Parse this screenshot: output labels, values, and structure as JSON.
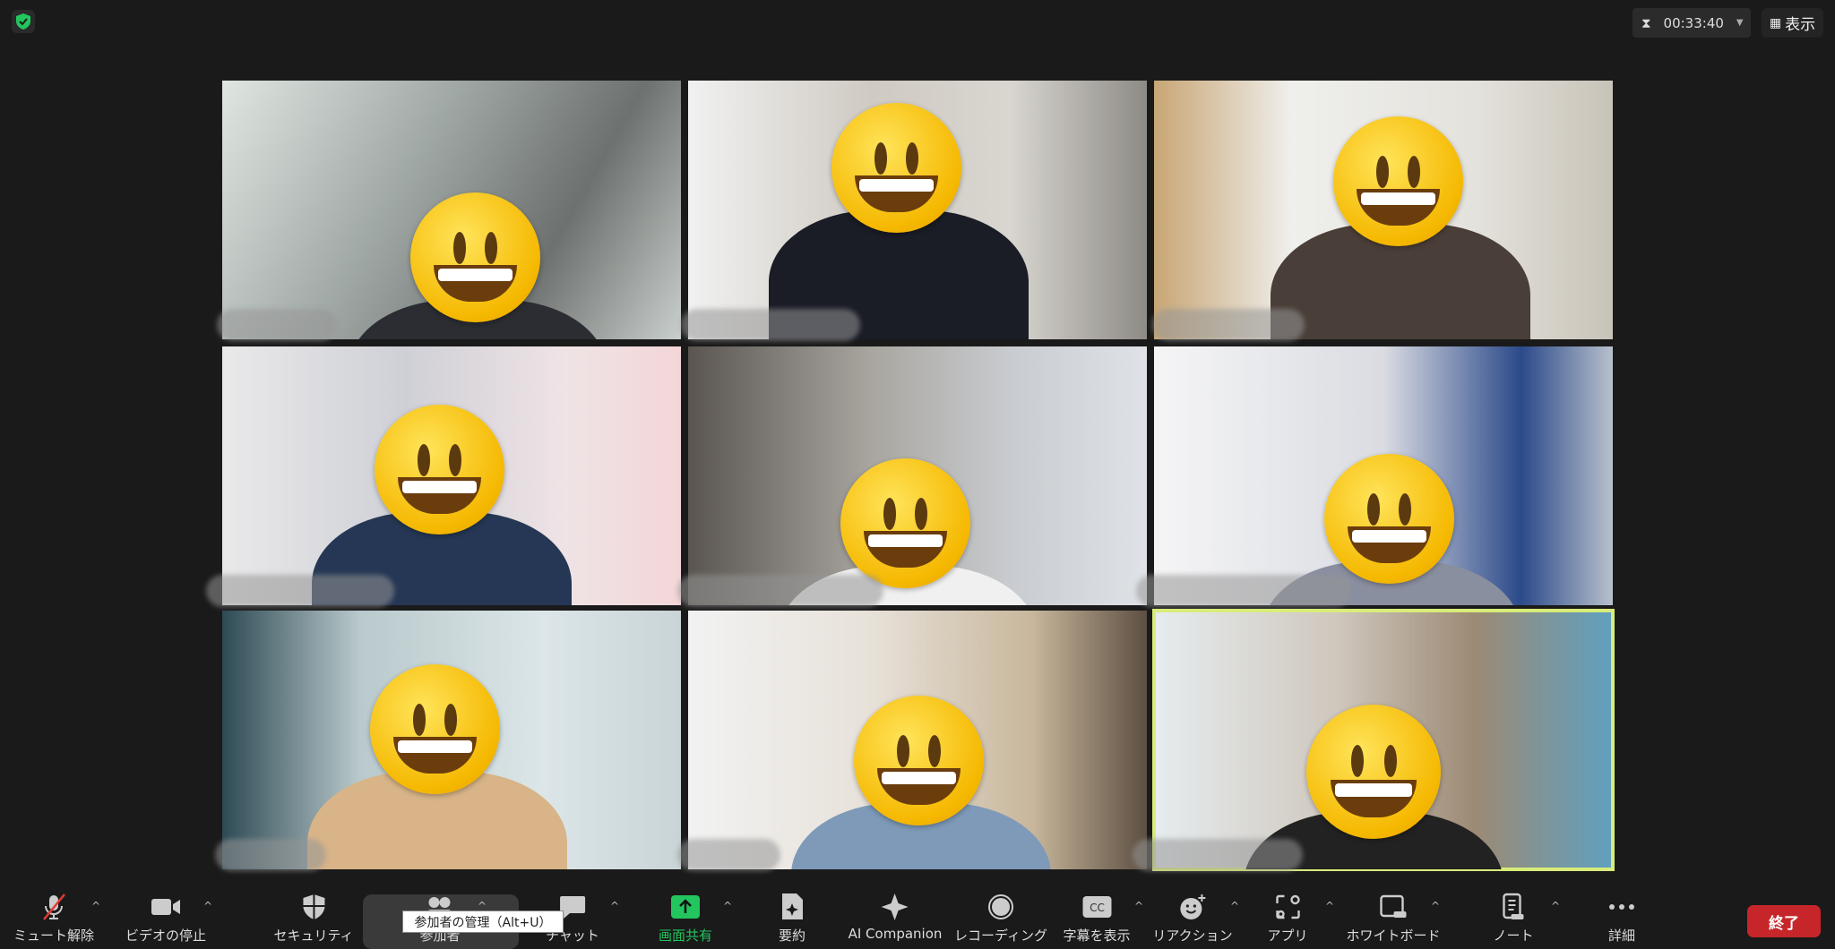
{
  "header": {
    "timer": "00:33:40",
    "view_label": "表示"
  },
  "colors": {
    "accent_green": "#22c55e",
    "end_red": "#c6262a",
    "active_border": "#d8ec7a"
  },
  "tiles": [
    {
      "bg": "linear-gradient(120deg,#dfe6e2,#9fa7a4 40%,#6d716f 70%,#c9cfcc)",
      "body": "#2b2d33",
      "face": [
        210,
        125
      ],
      "active": false
    },
    {
      "bg": "linear-gradient(90deg,#f1f1f1,#cfcac2 40%,#d9d6d0 70%,#8e8b86)",
      "body": "#1a1c26",
      "face": [
        160,
        25
      ],
      "active": false
    },
    {
      "bg": "linear-gradient(90deg,#c8a675,#efefec 30%,#e4e2dc 70%,#c8c3b8)",
      "body": "#4a3e38",
      "face": [
        200,
        40
      ],
      "active": false
    },
    {
      "bg": "linear-gradient(90deg,#e9e9ea,#cfd0d6 40%,#efe3e5 75%,#f4d6d8)",
      "body": "#253754",
      "face": [
        170,
        65
      ],
      "active": false
    },
    {
      "bg": "linear-gradient(90deg,#5a5550,#a9a6a0 40%,#c8cbcf 70%,#dfe2e6)",
      "body": "#f0f0f0",
      "face": [
        170,
        125
      ],
      "active": false
    },
    {
      "bg": "linear-gradient(90deg,#f5f5f6,#dadce2 50%,#2b4a8a 80%,#b8c0cc)",
      "body": "#8a8fa0",
      "face": [
        190,
        120
      ],
      "active": false
    },
    {
      "bg": "linear-gradient(90deg,#2e4a54,#b9c9cc 30%,#dce6e8 70%,#c9d4d6)",
      "body": "#d8b488",
      "face": [
        165,
        60
      ],
      "active": false
    },
    {
      "bg": "linear-gradient(90deg,#f2f2f2,#e7e1d9 40%,#c8b79c 75%,#5d4f42)",
      "body": "#7e9ab8",
      "face": [
        185,
        95
      ],
      "active": false
    },
    {
      "bg": "linear-gradient(90deg,#e6ecef,#cfc7bd 40%,#9c8a74 70%,#5fa0c0)",
      "body": "#222",
      "face": [
        170,
        105
      ],
      "active": true
    }
  ],
  "toolbar": {
    "items": [
      {
        "label": "ミュート解除",
        "icon": "mic-muted-icon",
        "caret": true
      },
      {
        "label": "ビデオの停止",
        "icon": "video-icon",
        "caret": true
      },
      {
        "label": "セキュリティ",
        "icon": "shield-icon",
        "caret": false
      },
      {
        "label": "参加者",
        "icon": "participants-icon",
        "caret": true
      },
      {
        "label": "チャット",
        "icon": "chat-icon",
        "caret": true
      },
      {
        "label": "画面共有",
        "icon": "share-screen-icon",
        "caret": true
      },
      {
        "label": "要約",
        "icon": "summary-icon",
        "caret": false
      },
      {
        "label": "AI Companion",
        "icon": "sparkle-icon",
        "caret": false
      },
      {
        "label": "レコーディング",
        "icon": "record-icon",
        "caret": false
      },
      {
        "label": "字幕を表示",
        "icon": "cc-icon",
        "caret": true
      },
      {
        "label": "リアクション",
        "icon": "reaction-icon",
        "caret": true
      },
      {
        "label": "アプリ",
        "icon": "apps-icon",
        "caret": true
      },
      {
        "label": "ホワイトボード",
        "icon": "whiteboard-icon",
        "caret": true
      },
      {
        "label": "ノート",
        "icon": "notes-icon",
        "caret": true
      },
      {
        "label": "詳細",
        "icon": "more-icon",
        "caret": false
      }
    ],
    "tooltip": "参加者の管理（Alt+U）",
    "end_label": "終了"
  }
}
